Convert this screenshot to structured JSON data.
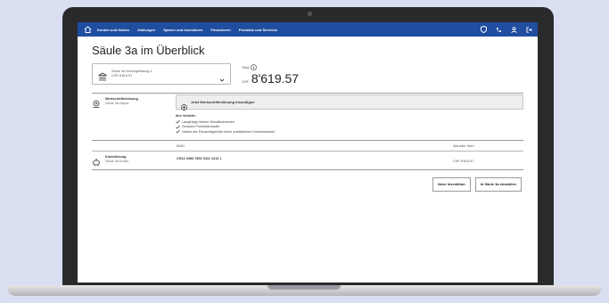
{
  "nav": {
    "items": [
      "Konten und Karten",
      "Zahlungen",
      "Sparen und Investieren",
      "Finanzieren",
      "Produkte und Services"
    ],
    "icons": [
      "home-icon",
      "shield-icon",
      "phone-icon",
      "user-icon",
      "logout-icon"
    ]
  },
  "page": {
    "title": "Säule 3a im Überblick"
  },
  "selector": {
    "line1": "Säule 3a Vorsorgelösung 1",
    "line2": "CHF 8'619.57"
  },
  "total": {
    "label": "Total",
    "currency": "CHF",
    "amount": "8'619.57"
  },
  "depot": {
    "title": "Wertschriftenlösung",
    "subtitle": "Säule 3a Depot",
    "add_label": "Jetzt Wertschriftenlösung hinzufügen",
    "pro_heading": "Ihre Vorteile:",
    "pros": [
      "Langfristig höhere Renditechancen",
      "Grosses Produktauswahl",
      "Neben der Pauschalgebühr keine zusätzlichen Kommissionen"
    ]
  },
  "table": {
    "col_iban": "IBAN",
    "col_value": "Aktueller Wert",
    "row": {
      "title": "Kontolösung",
      "subtitle": "Säule 3a Konto",
      "iban": "CH12 3456 7891 0111 1213 1",
      "value": "CHF 8'619.57"
    }
  },
  "buttons": {
    "new_investment": "Neue Investition",
    "deposit": "In Säule 3a einzahlen"
  },
  "colors": {
    "nav": "#1f4da0",
    "background": "#d9dff0",
    "bezel": "#2a2a2c"
  }
}
